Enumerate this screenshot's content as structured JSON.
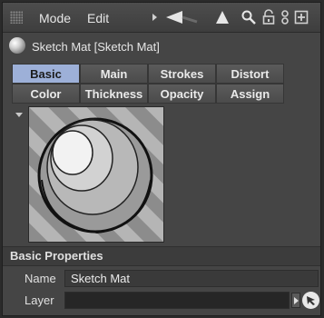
{
  "toolbar": {
    "menus": [
      "Mode",
      "Edit"
    ],
    "icons": [
      "grip-icon",
      "play-arrow-icon",
      "back-arrow-icon",
      "up-arrow-icon",
      "search-icon",
      "lock-icon",
      "link-icon",
      "add-icon"
    ]
  },
  "material": {
    "title": "Sketch Mat [Sketch Mat]"
  },
  "tabs": [
    {
      "label": "Basic",
      "active": true
    },
    {
      "label": "Main",
      "active": false
    },
    {
      "label": "Strokes",
      "active": false
    },
    {
      "label": "Distort",
      "active": false
    },
    {
      "label": "Color",
      "active": false
    },
    {
      "label": "Thickness",
      "active": false
    },
    {
      "label": "Opacity",
      "active": false
    },
    {
      "label": "Assign",
      "active": false
    }
  ],
  "section": {
    "title": "Basic Properties"
  },
  "fields": {
    "name_label": "Name",
    "name_value": "Sketch Mat",
    "layer_label": "Layer",
    "layer_value": ""
  },
  "colors": {
    "active_tab": "#9db0d8",
    "panel_bg": "#454545"
  }
}
